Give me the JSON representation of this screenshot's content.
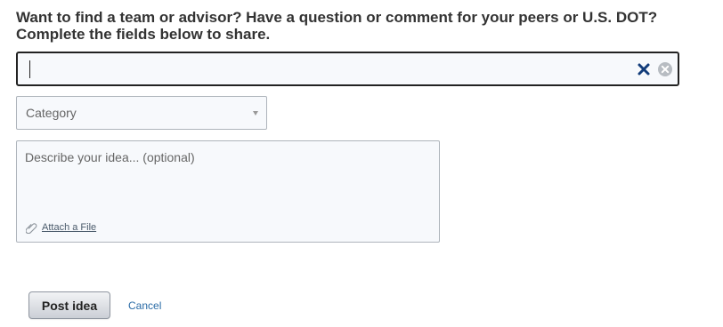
{
  "prompt": {
    "heading": "Want to find a team or advisor? Have a question or comment for your peers or U.S. DOT? Complete the fields below to share."
  },
  "title_field": {
    "value": "",
    "clear_icon": "x-icon",
    "clear_circle_icon": "close-circle-icon"
  },
  "category": {
    "selected": "Category"
  },
  "description": {
    "value": "",
    "placeholder": "Describe your idea... (optional)",
    "attach_label": "Attach a File",
    "attach_icon": "paperclip-icon"
  },
  "actions": {
    "post_label": "Post idea",
    "cancel_label": "Cancel"
  },
  "colors": {
    "field_background": "#f7f9fc",
    "field_border": "#aeb4bb",
    "active_border": "#222222",
    "link": "#2a6ba6"
  }
}
